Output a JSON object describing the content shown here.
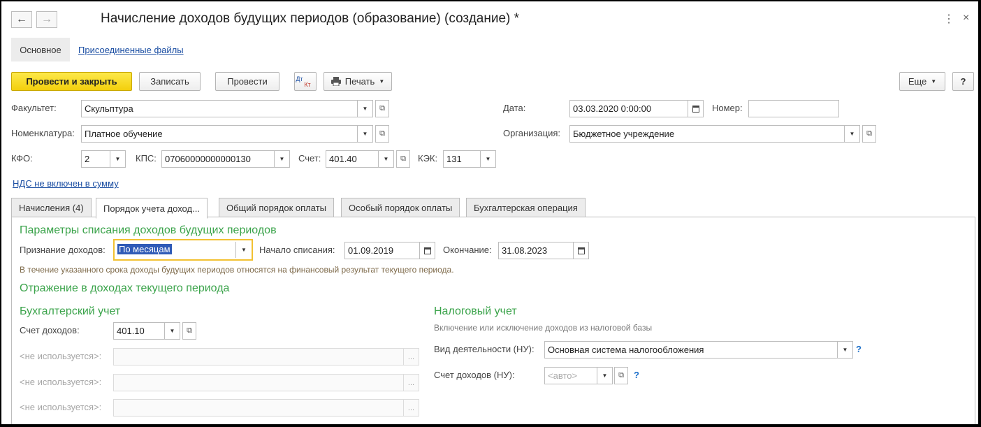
{
  "window": {
    "title": "Начисление доходов будущих периодов (образование) (создание) *",
    "back_icon": "←",
    "forward_icon": "→",
    "more_icon": "⋮",
    "close_icon": "×"
  },
  "top_tabs": {
    "main": "Основное",
    "files": "Присоединенные файлы"
  },
  "toolbar": {
    "post_close": "Провести и закрыть",
    "save": "Записать",
    "post": "Провести",
    "dtkt_top": "Дт",
    "dtkt_bottom": "Кт",
    "print": "Печать",
    "more": "Еще",
    "help": "?"
  },
  "form": {
    "faculty_label": "Факультет:",
    "faculty_value": "Скульптура",
    "nomenclature_label": "Номенклатура:",
    "nomenclature_value": "Платное обучение",
    "kfo_label": "КФО:",
    "kfo_value": "2",
    "kps_label": "КПС:",
    "kps_value": "07060000000000130",
    "account_label": "Счет:",
    "account_value": "401.40",
    "kek_label": "КЭК:",
    "kek_value": "131",
    "date_label": "Дата:",
    "date_value": "03.03.2020  0:00:00",
    "number_label": "Номер:",
    "number_value": "",
    "org_label": "Организация:",
    "org_value": "Бюджетное учреждение",
    "vat_link": "НДС не включен в сумму"
  },
  "tabs": [
    "Начисления (4)",
    "Порядок учета доход...",
    "Общий порядок оплаты",
    "Особый порядок оплаты",
    "Бухгалтерская операция"
  ],
  "panel": {
    "params_heading": "Параметры списания доходов будущих периодов",
    "recognition_label": "Признание доходов:",
    "recognition_value": "По месяцам",
    "start_label": "Начало списания:",
    "start_value": "01.09.2019",
    "end_label": "Окончание:",
    "end_value": "31.08.2023",
    "note": "В течение указанного срока доходы будущих периодов относятся на финансовый результат текущего периода.",
    "reflect_heading": "Отражение в доходах текущего периода",
    "accounting_heading": "Бухгалтерский учет",
    "income_account_label": "Счет доходов:",
    "income_account_value": "401.10",
    "unused_label": "<не используется>:",
    "tax_heading": "Налоговый учет",
    "tax_note": "Включение или исключение доходов из налоговой базы",
    "activity_label": "Вид деятельности (НУ):",
    "activity_value": "Основная система налогообложения",
    "tax_account_label": "Счет доходов (НУ):",
    "tax_account_placeholder": "<авто>",
    "help_mark": "?"
  }
}
